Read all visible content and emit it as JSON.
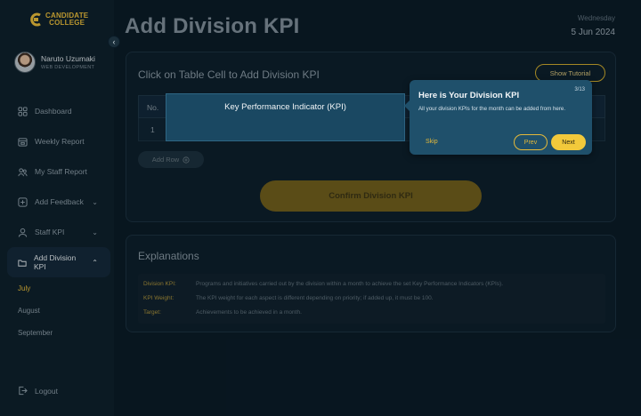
{
  "brand": {
    "line1": "CANDIDATE",
    "line2": "COLLEGE",
    "color": "#e4b93a"
  },
  "user": {
    "name": "Naruto Uzumaki",
    "role": "WEB DEVELOPMENT"
  },
  "sidebar": {
    "items": [
      {
        "label": "Dashboard",
        "icon": "grid-icon"
      },
      {
        "label": "Weekly Report",
        "icon": "calendar-icon"
      },
      {
        "label": "My Staff Report",
        "icon": "users-icon"
      },
      {
        "label": "Add Feedback",
        "icon": "plus-square-icon",
        "expandable": true
      },
      {
        "label": "Staff KPI",
        "icon": "user-icon",
        "expandable": true
      },
      {
        "label": "Add Division KPI",
        "icon": "folder-icon",
        "expandable": true,
        "active": true
      }
    ],
    "sub_items": [
      {
        "label": "July",
        "active": true
      },
      {
        "label": "August"
      },
      {
        "label": "September"
      }
    ],
    "logout_label": "Logout"
  },
  "header": {
    "title": "Add Division KPI",
    "day": "Wednesday",
    "date": "5 Jun 2024"
  },
  "kpi_card": {
    "title": "Click on Table Cell to Add Division KPI",
    "tutorial_label": "Show Tutorial",
    "columns": [
      "No.",
      "Key Performance Indicator (KPI)"
    ],
    "rows": [
      [
        "1",
        ""
      ]
    ],
    "add_row_label": "Add Row",
    "confirm_label": "Confirm Division KPI"
  },
  "explanations": {
    "title": "Explanations",
    "rows": [
      {
        "term": "Division KPI:",
        "desc": "Programs and initiatives carried out by the division within a month to achieve the set Key Performance Indicators (KPIs)."
      },
      {
        "term": "KPI Weight:",
        "desc": "The KPI weight for each aspect is different depending on priority; if added up, it must be 100."
      },
      {
        "term": "Target:",
        "desc": "Achievements to be achieved in a month."
      }
    ]
  },
  "tour": {
    "counter": "3/13",
    "title": "Here is Your Division KPI",
    "body": "All your division KPIs for the month can be added from here.",
    "skip_label": "Skip",
    "prev_label": "Prev",
    "next_label": "Next"
  }
}
